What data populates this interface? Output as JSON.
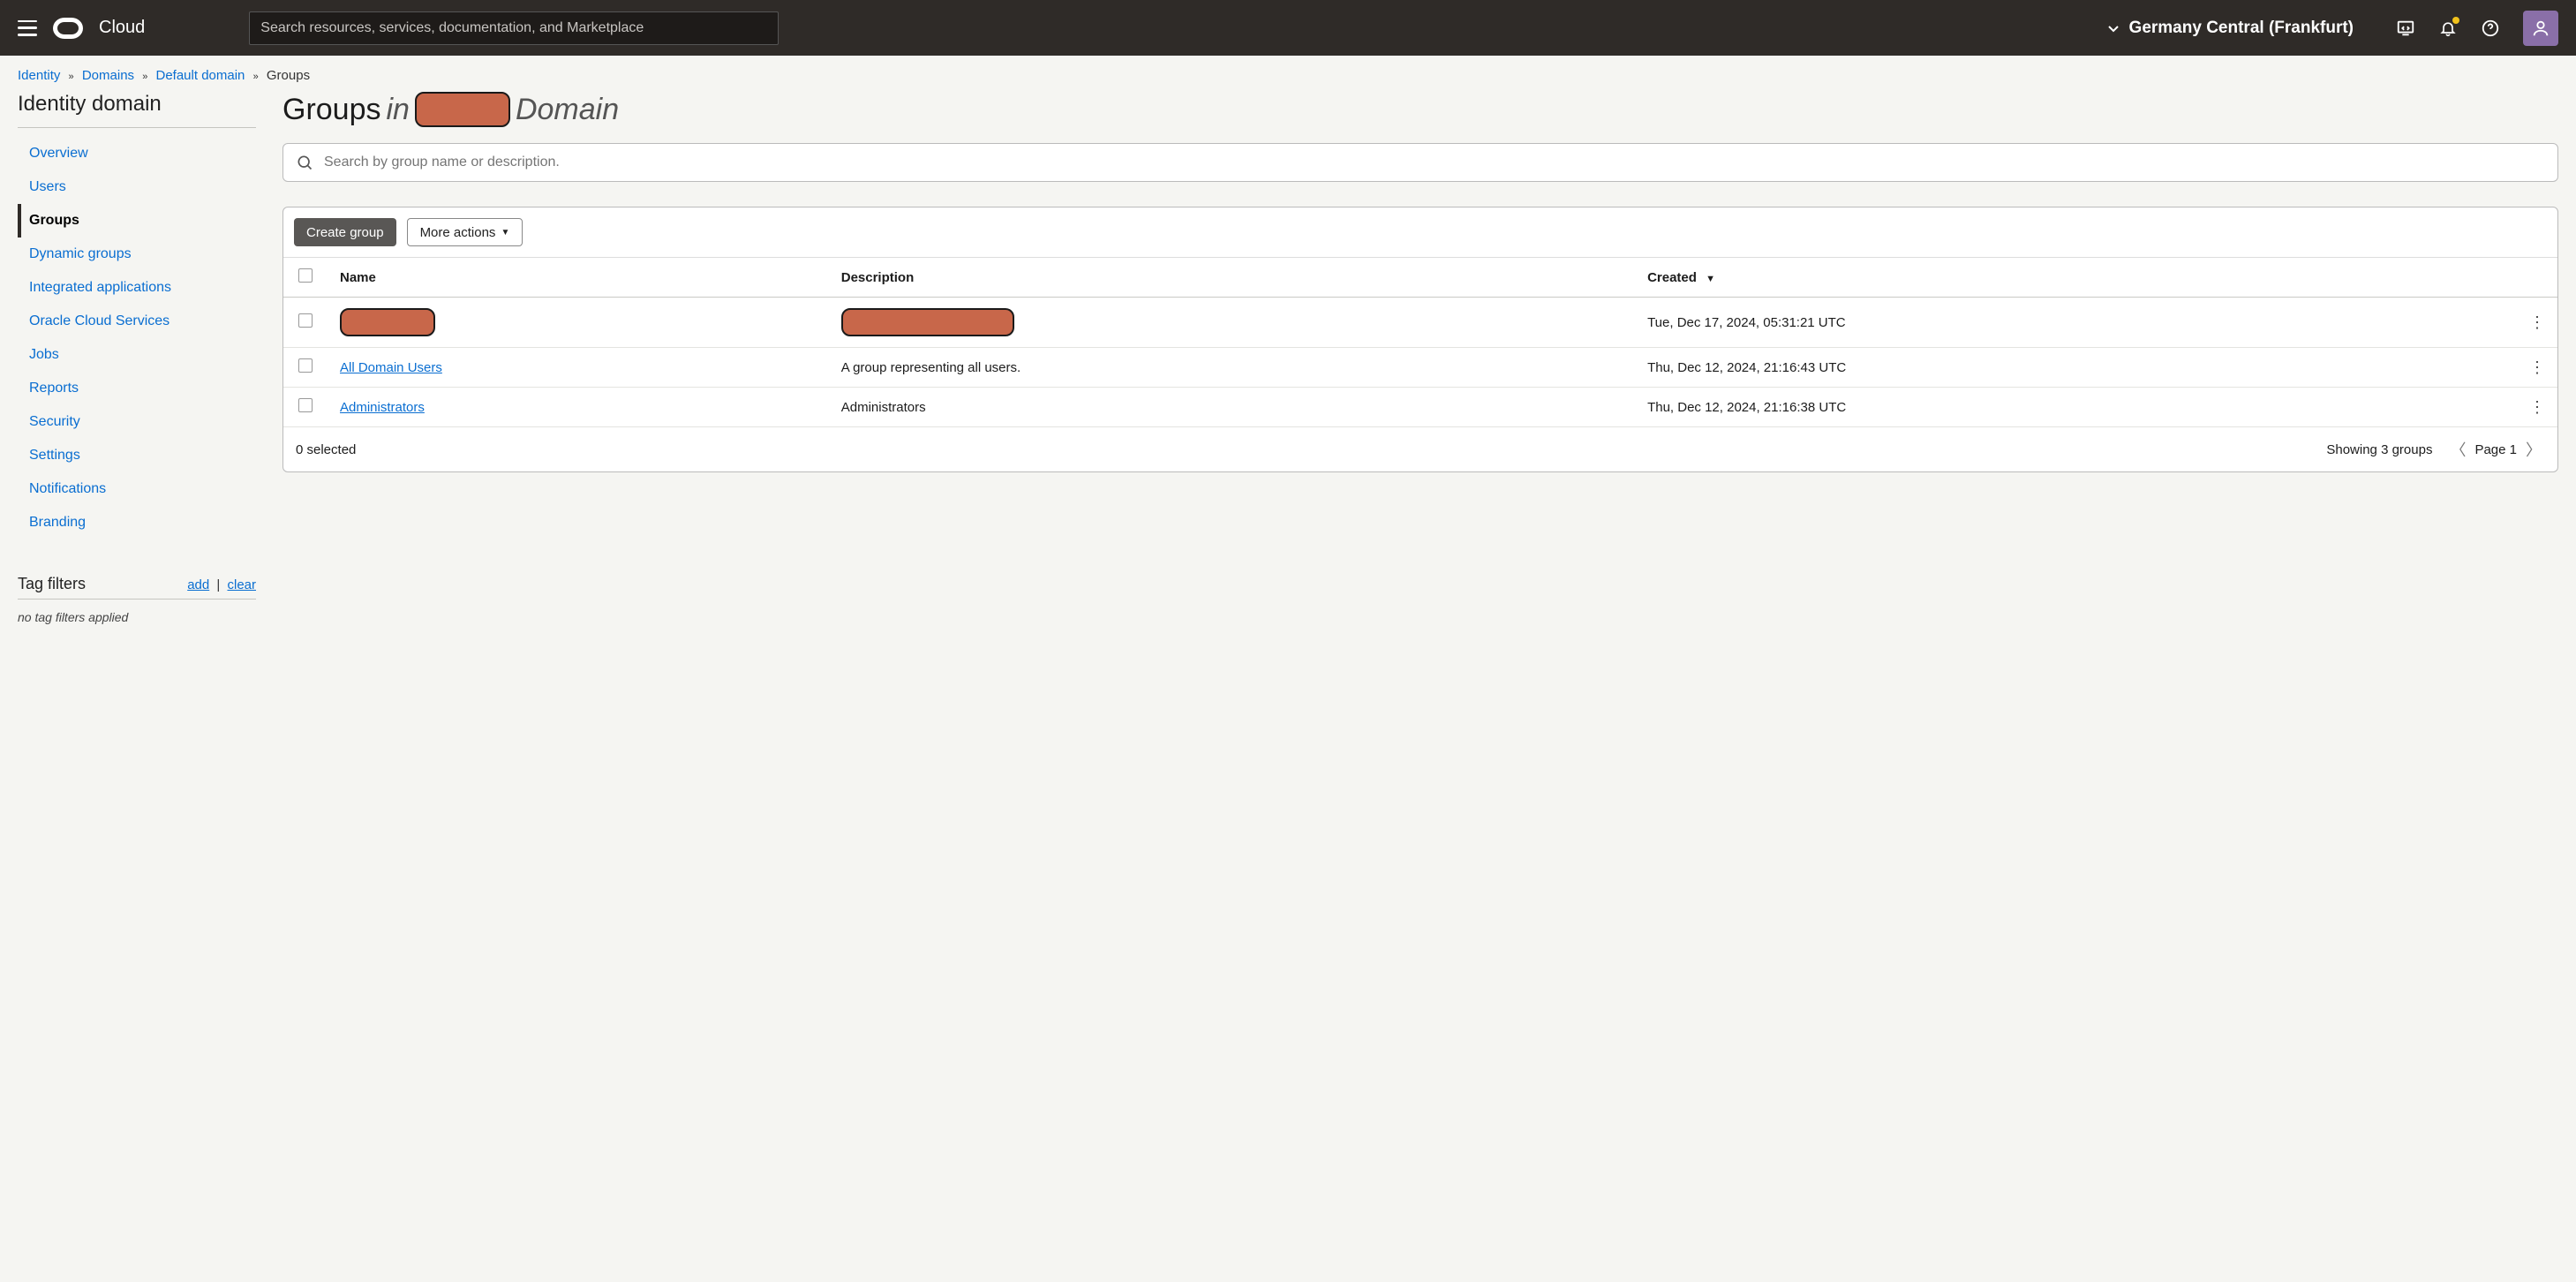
{
  "header": {
    "brand": "Cloud",
    "search_placeholder": "Search resources, services, documentation, and Marketplace",
    "region": "Germany Central (Frankfurt)"
  },
  "breadcrumb": {
    "items": [
      {
        "label": "Identity",
        "link": true
      },
      {
        "label": "Domains",
        "link": true
      },
      {
        "label": "Default domain",
        "link": true
      },
      {
        "label": "Groups",
        "link": false
      }
    ]
  },
  "sidebar": {
    "title": "Identity domain",
    "items": [
      {
        "label": "Overview",
        "active": false
      },
      {
        "label": "Users",
        "active": false
      },
      {
        "label": "Groups",
        "active": true
      },
      {
        "label": "Dynamic groups",
        "active": false
      },
      {
        "label": "Integrated applications",
        "active": false
      },
      {
        "label": "Oracle Cloud Services",
        "active": false
      },
      {
        "label": "Jobs",
        "active": false
      },
      {
        "label": "Reports",
        "active": false
      },
      {
        "label": "Security",
        "active": false
      },
      {
        "label": "Settings",
        "active": false
      },
      {
        "label": "Notifications",
        "active": false
      },
      {
        "label": "Branding",
        "active": false
      }
    ],
    "tag_filters": {
      "title": "Tag filters",
      "add": "add",
      "clear": "clear",
      "empty": "no tag filters applied"
    }
  },
  "page": {
    "title_prefix": "Groups",
    "title_in": "in",
    "title_suffix": "Domain",
    "redacted_domain": "[redacted]",
    "search_placeholder": "Search by group name or description."
  },
  "toolbar": {
    "create": "Create group",
    "more": "More actions"
  },
  "table": {
    "columns": {
      "name": "Name",
      "description": "Description",
      "created": "Created"
    },
    "rows": [
      {
        "name": "[redacted]",
        "name_redacted": true,
        "description": "[redacted]",
        "description_redacted": true,
        "created": "Tue, Dec 17, 2024, 05:31:21 UTC"
      },
      {
        "name": "All Domain Users",
        "name_redacted": false,
        "description": "A group representing all users.",
        "description_redacted": false,
        "created": "Thu, Dec 12, 2024, 21:16:43 UTC"
      },
      {
        "name": "Administrators",
        "name_redacted": false,
        "description": "Administrators",
        "description_redacted": false,
        "created": "Thu, Dec 12, 2024, 21:16:38 UTC"
      }
    ],
    "footer": {
      "selected": "0 selected",
      "showing": "Showing 3 groups",
      "page": "Page 1"
    }
  }
}
